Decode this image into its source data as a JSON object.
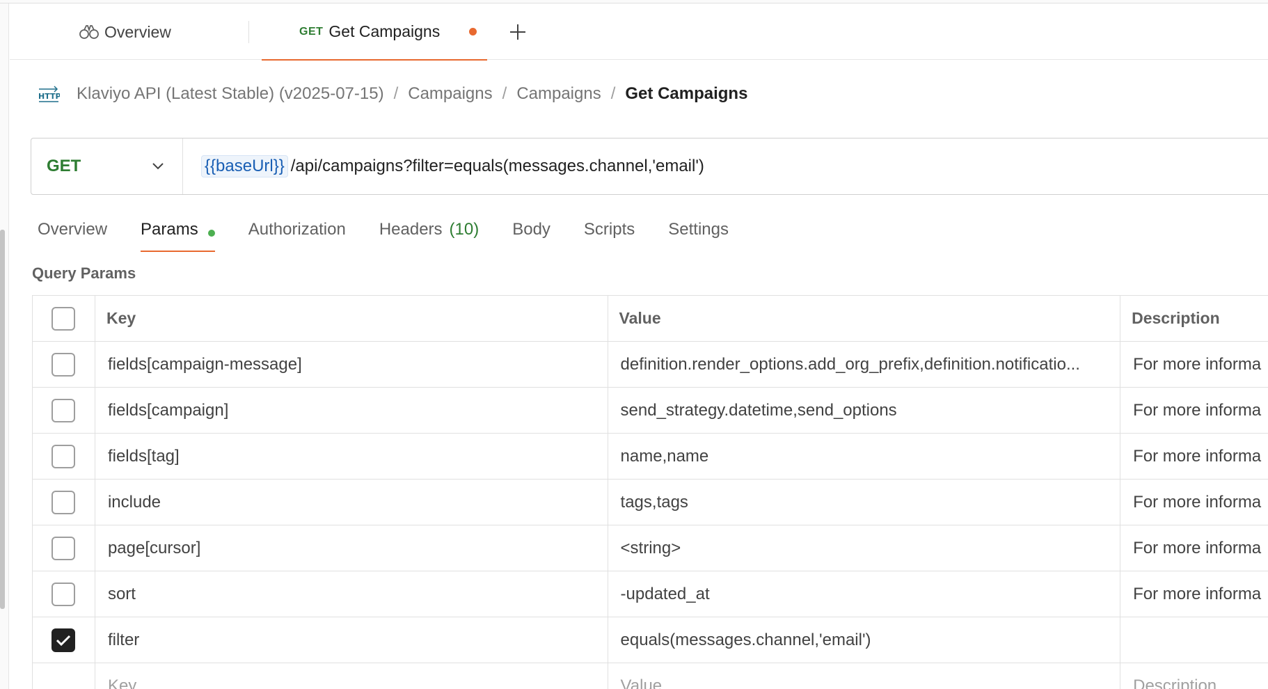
{
  "tabs": {
    "overview_label": "Overview",
    "active": {
      "method": "GET",
      "title": "Get Campaigns"
    }
  },
  "breadcrumb": {
    "items": [
      "Klaviyo API (Latest Stable) (v2025-07-15)",
      "Campaigns",
      "Campaigns"
    ],
    "current": "Get Campaigns",
    "separator": "/"
  },
  "request": {
    "method": "GET",
    "url_variable": "{{baseUrl}}",
    "url_path": "/api/campaigns?filter=equals(messages.channel,'email')"
  },
  "request_tabs": {
    "overview": "Overview",
    "params": "Params",
    "authorization": "Authorization",
    "headers": "Headers",
    "headers_count": "(10)",
    "body": "Body",
    "scripts": "Scripts",
    "settings": "Settings"
  },
  "query_params": {
    "title": "Query Params",
    "columns": {
      "key": "Key",
      "value": "Value",
      "description": "Description"
    },
    "rows": [
      {
        "checked": false,
        "key": "fields[campaign-message]",
        "value": "definition.render_options.add_org_prefix,definition.notificatio...",
        "description": "For more informa"
      },
      {
        "checked": false,
        "key": "fields[campaign]",
        "value": "send_strategy.datetime,send_options",
        "description": "For more informa"
      },
      {
        "checked": false,
        "key": "fields[tag]",
        "value": "name,name",
        "description": "For more informa"
      },
      {
        "checked": false,
        "key": "include",
        "value": "tags,tags",
        "description": "For more informa"
      },
      {
        "checked": false,
        "key": "page[cursor]",
        "value": "<string>",
        "description": "For more informa"
      },
      {
        "checked": false,
        "key": "sort",
        "value": "-updated_at",
        "description": "For more informa"
      },
      {
        "checked": true,
        "key": "filter",
        "value": "equals(messages.channel,'email')",
        "description": ""
      }
    ],
    "placeholders": {
      "key": "Key",
      "value": "Value",
      "description": "Description"
    }
  },
  "colors": {
    "accent": "#e8692f",
    "get_method": "#2e7d32",
    "params_indicator": "#4caf50",
    "variable": "#1a5fb4"
  }
}
